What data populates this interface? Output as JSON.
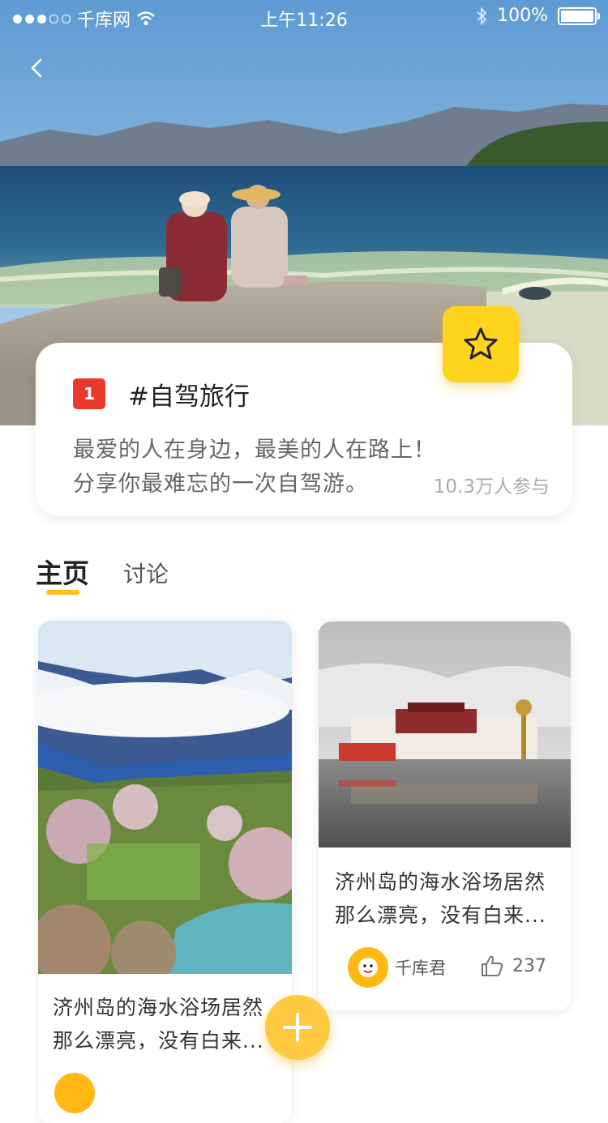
{
  "status_bar": {
    "carrier": "千库网",
    "time": "上午11:26",
    "battery": "100%"
  },
  "topic": {
    "rank": "1",
    "title": "#自驾旅行",
    "desc_line1": "最爱的人在身边，最美的人在路上！",
    "desc_line2": "分享你最难忘的一次自驾游。",
    "participants": "10.3万人参与"
  },
  "tabs": [
    {
      "label": "主页",
      "active": true
    },
    {
      "label": "讨论",
      "active": false
    }
  ],
  "posts": [
    {
      "title_line1": "济州岛的海水浴场居然",
      "title_line2": "那么漂亮，没有白来...",
      "image": "mountain-valley-photo"
    },
    {
      "title_line1": "济州岛的海水浴场居然",
      "title_line2": "那么漂亮，没有白来...",
      "author": "千库君",
      "likes": "237",
      "image": "palace-photo"
    }
  ],
  "colors": {
    "accent_yellow": "#ffd41f",
    "rank_red": "#ea3a2e",
    "tab_indicator": "#ffc01b"
  }
}
